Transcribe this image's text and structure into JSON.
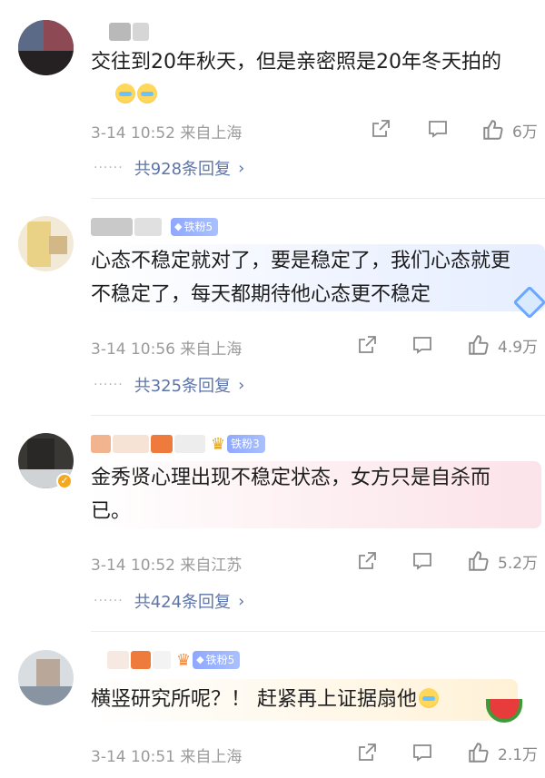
{
  "comments": [
    {
      "text": "交往到20年秋天，但是亲密照是20年冬天拍的",
      "time_location": "3-14 10:52 来自上海",
      "likes": "6万",
      "replies": "共928条回复",
      "bubble_color": "#ffffff"
    },
    {
      "fan_badge": "铁粉5",
      "text": "心态不稳定就对了，要是稳定了，我们心态就更不稳定了，每天都期待他心态更不稳定",
      "time_location": "3-14 10:56 来自上海",
      "likes": "4.9万",
      "replies": "共325条回复",
      "bubble_color": "#eef3ff"
    },
    {
      "fan_badge": "铁粉3",
      "text": "金秀贤心理出现不稳定状态，女方只是自杀而已。",
      "time_location": "3-14 10:52 来自江苏",
      "likes": "5.2万",
      "replies": "共424条回复",
      "bubble_color": "#fdebef"
    },
    {
      "fan_badge": "铁粉5",
      "text": "横竖研究所呢？！ 赶紧再上证据扇他",
      "time_location": "3-14 10:51 来自上海",
      "likes": "2.1万",
      "bubble_color": "#fff6e4"
    }
  ],
  "icons": {
    "share": "share-icon",
    "comment": "comment-icon",
    "like": "thumbs-up-icon",
    "more_replies": "chevron-right-icon"
  },
  "colors": {
    "reply_link": "#5d74a9",
    "meta_gray": "#9a9a9a",
    "fan_badge": "#98b0ff"
  }
}
